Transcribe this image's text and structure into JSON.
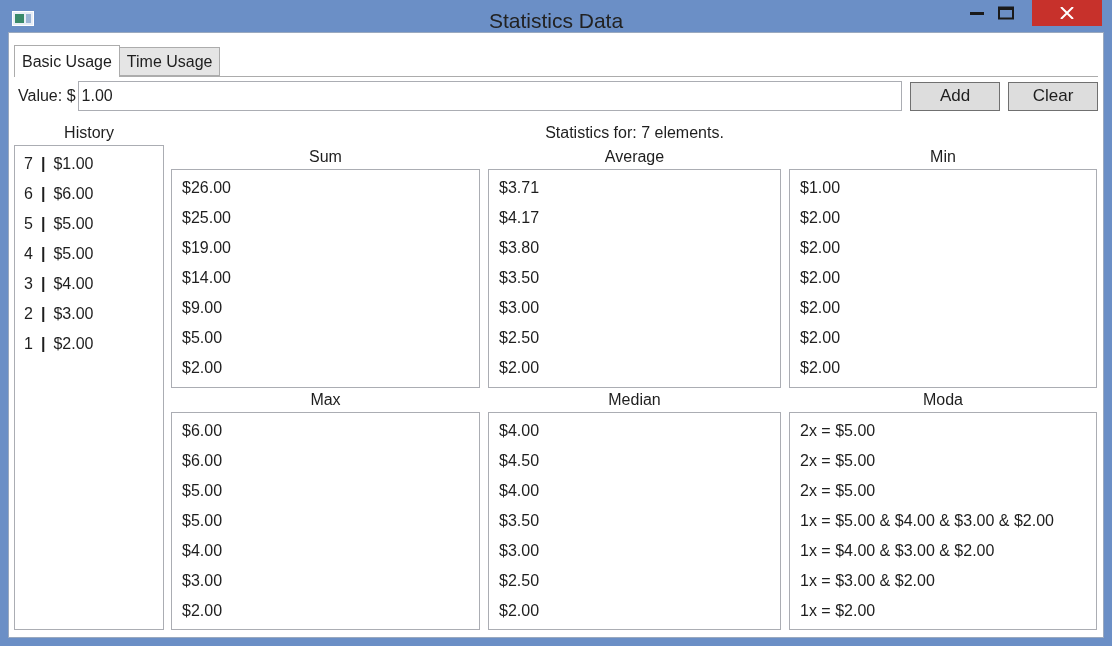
{
  "window": {
    "title": "Statistics Data"
  },
  "tabs": [
    {
      "label": "Basic Usage",
      "selected": true
    },
    {
      "label": "Time Usage",
      "selected": false
    }
  ],
  "value_field": {
    "label": "Value: $",
    "value": "1.00"
  },
  "buttons": [
    "Add",
    "Clear"
  ],
  "history": {
    "title": "History",
    "items": [
      {
        "number": "7",
        "separator": "|",
        "amount": "$1.00"
      },
      {
        "number": "6",
        "separator": "|",
        "amount": "$6.00"
      },
      {
        "number": "5",
        "separator": "|",
        "amount": "$5.00"
      },
      {
        "number": "4",
        "separator": "|",
        "amount": "$5.00"
      },
      {
        "number": "3",
        "separator": "|",
        "amount": "$4.00"
      },
      {
        "number": "2",
        "separator": "|",
        "amount": "$3.00"
      },
      {
        "number": "1",
        "separator": "|",
        "amount": "$2.00"
      }
    ]
  },
  "statistics": {
    "summary": "Statistics for: 7 elements.",
    "panels": [
      {
        "title": "Sum",
        "values": [
          "$26.00",
          "$25.00",
          "$19.00",
          "$14.00",
          "$9.00",
          "$5.00",
          "$2.00"
        ]
      },
      {
        "title": "Average",
        "values": [
          "$3.71",
          "$4.17",
          "$3.80",
          "$3.50",
          "$3.00",
          "$2.50",
          "$2.00"
        ]
      },
      {
        "title": "Min",
        "values": [
          "$1.00",
          "$2.00",
          "$2.00",
          "$2.00",
          "$2.00",
          "$2.00",
          "$2.00"
        ]
      },
      {
        "title": "Max",
        "values": [
          "$6.00",
          "$6.00",
          "$5.00",
          "$5.00",
          "$4.00",
          "$3.00",
          "$2.00"
        ]
      },
      {
        "title": "Median",
        "values": [
          "$4.00",
          "$4.50",
          "$4.00",
          "$3.50",
          "$3.00",
          "$2.50",
          "$2.00"
        ]
      },
      {
        "title": "Moda",
        "values": [
          "2x = $5.00",
          "2x = $5.00",
          "2x = $5.00",
          "1x = $5.00 & $4.00 & $3.00 & $2.00",
          "1x = $4.00 & $3.00 & $2.00",
          "1x = $3.00 & $2.00",
          "1x = $2.00"
        ]
      }
    ]
  }
}
